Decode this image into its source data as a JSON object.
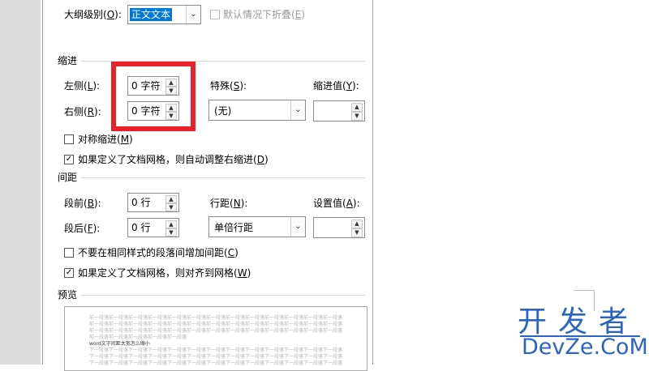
{
  "outline": {
    "label": "大纲级别(",
    "key": "O",
    "suffix": "):",
    "value": "正文文本",
    "collapse_label": "默认情况下折叠(",
    "collapse_key": "E",
    "collapse_suffix": ")"
  },
  "indent": {
    "section": "缩进",
    "left_label": "左侧(",
    "left_key": "L",
    "left_value": "0 字符",
    "right_label": "右侧(",
    "right_key": "R",
    "right_value": "0 字符",
    "special_label": "特殊(",
    "special_key": "S",
    "special_value": "(无)",
    "by_label": "缩进值(",
    "by_key": "Y",
    "mirror_label": "对称缩进(",
    "mirror_key": "M",
    "auto_label": "如果定义了文档网格，则自动调整右缩进(",
    "auto_key": "D"
  },
  "spacing": {
    "section": "间距",
    "before_label": "段前(",
    "before_key": "B",
    "before_value": "0 行",
    "after_label": "段后(",
    "after_key": "F",
    "after_value": "0 行",
    "line_label": "行距(",
    "line_key": "N",
    "line_value": "单倍行距",
    "at_label": "设置值(",
    "at_key": "A",
    "nospace_label": "不要在相同样式的段落间增加间距(",
    "nospace_key": "C",
    "snap_label": "如果定义了文档网格，则对齐到网格(",
    "snap_key": "W"
  },
  "common": {
    "close_colon": "):",
    "close": ")",
    "check_mark": "✓",
    "up_arrow": "▲",
    "down_arrow": "▼",
    "combo_arrow": "⌄"
  },
  "preview": {
    "section": "预览",
    "prev_line": "前一段落前一段落前一段落前一段落前一段落前一段落前一段落前一段落前一段落前一段落前一段落前一段落前一段落",
    "prev_short": "前一段落前一段落前一段落前一段落前一段落",
    "sample": "word文字间距太宽怎么缩小",
    "next_line": "下一段落下一段落下一段落下一段落下一段落下一段落下一段落下一段落下一段落下一段落下一段落下一段落下一段落"
  },
  "watermark": {
    "main": "开发者",
    "sub": "DevZe.CoM"
  },
  "colors": {
    "highlight_box": "#e8212b",
    "logo": "#2b64c5",
    "selection": "#0078d7"
  }
}
